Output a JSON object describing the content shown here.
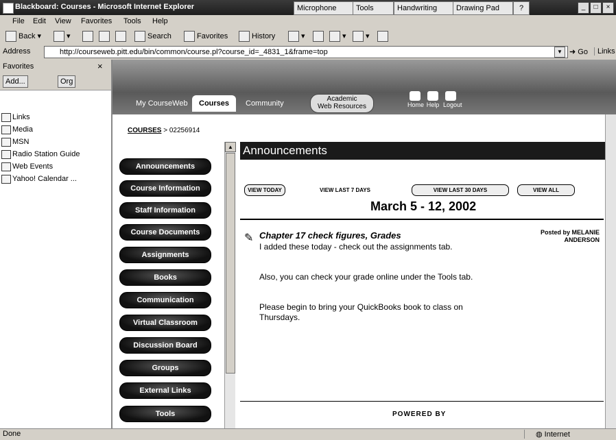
{
  "window": {
    "title": "Blackboard: Courses - Microsoft Internet Explorer",
    "langbar": [
      "Microphone",
      "Tools",
      "Handwriting",
      "Drawing Pad",
      "?"
    ]
  },
  "menu": [
    "File",
    "Edit",
    "View",
    "Favorites",
    "Tools",
    "Help"
  ],
  "toolbar": {
    "back": "Back",
    "search": "Search",
    "favorites": "Favorites",
    "history": "History"
  },
  "address": {
    "label": "Address",
    "url": "http://courseweb.pitt.edu/bin/common/course.pl?course_id=_4831_1&frame=top",
    "go": "Go",
    "links": "Links"
  },
  "favorites": {
    "title": "Favorites",
    "add": "Add...",
    "organize": "Org",
    "items": [
      "Links",
      "Media",
      "MSN",
      "Radio Station Guide",
      "Web Events",
      "Yahoo! Calendar ..."
    ]
  },
  "bb": {
    "tabs": [
      "My CourseWeb",
      "Courses",
      "Community"
    ],
    "academic": [
      "Academic",
      "Web Resources"
    ],
    "icons": [
      "Home",
      "Help",
      "Logout"
    ],
    "breadcrumb_link": "COURSES",
    "breadcrumb_rest": "> 02256914",
    "nav": [
      "Announcements",
      "Course Information",
      "Staff Information",
      "Course Documents",
      "Assignments",
      "Books",
      "Communication",
      "Virtual Classroom",
      "Discussion Board",
      "Groups",
      "External Links",
      "Tools"
    ]
  },
  "announcements": {
    "header": "Announcements",
    "views": [
      "VIEW TODAY",
      "VIEW LAST 7 DAYS",
      "VIEW LAST 30 DAYS",
      "VIEW ALL"
    ],
    "date_range": "March 5 - 12, 2002",
    "item_title": "Chapter 17 check figures, Grades",
    "posted_by": "Posted by MELANIE ANDERSON",
    "paragraphs": [
      "I added these today - check out the assignments tab.",
      "Also, you can check your grade online under the Tools tab.",
      "Please begin to bring your QuickBooks book to class on Thursdays."
    ],
    "powered_by": "POWERED BY"
  },
  "status": {
    "left": "Done",
    "zone": "Internet"
  }
}
